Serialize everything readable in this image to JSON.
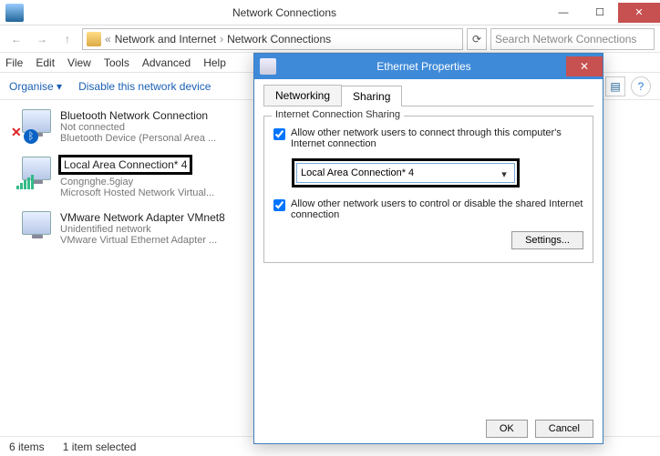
{
  "window": {
    "title": "Network Connections",
    "min": "—",
    "max": "☐",
    "close": "✕"
  },
  "breadcrumb": {
    "prefix": "«",
    "p1": "Network and Internet",
    "p2": "Network Connections",
    "sep": "›"
  },
  "search": {
    "placeholder": "Search Network Connections"
  },
  "menu": {
    "file": "File",
    "edit": "Edit",
    "view": "View",
    "tools": "Tools",
    "advanced": "Advanced",
    "help": "Help"
  },
  "toolbar": {
    "organise": "Organise ▾",
    "disable": "Disable this network device"
  },
  "connections": [
    {
      "name": "Bluetooth Network Connection",
      "status": "Not connected",
      "device": "Bluetooth Device (Personal Area ...",
      "kind": "bt"
    },
    {
      "name": "Local Area Connection* 4",
      "status": "Congnghe.5giay",
      "device": "Microsoft Hosted Network Virtual...",
      "kind": "wifi",
      "highlight": true
    },
    {
      "name": "VMware Network Adapter VMnet8",
      "status": "Unidentified network",
      "device": "VMware Virtual Ethernet Adapter ...",
      "kind": "vm"
    }
  ],
  "statusbar": {
    "count": "6 items",
    "selected": "1 item selected"
  },
  "dialog": {
    "title": "Ethernet Properties",
    "close": "✕",
    "tabs": {
      "networking": "Networking",
      "sharing": "Sharing"
    },
    "groupTitle": "Internet Connection Sharing",
    "allowConnect": "Allow other network users to connect through this computer's Internet connection",
    "dropdownValue": "Local Area Connection* 4",
    "allowControl": "Allow other network users to control or disable the shared Internet connection",
    "settings": "Settings...",
    "ok": "OK",
    "cancel": "Cancel"
  }
}
